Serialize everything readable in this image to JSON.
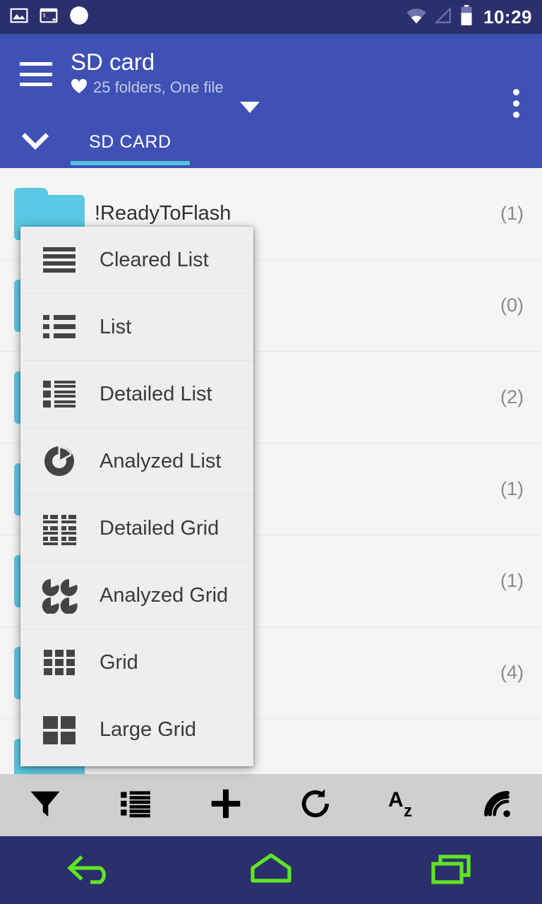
{
  "status_bar": {
    "icons": [
      "image-icon",
      "terminal-icon",
      "circle-icon"
    ],
    "wifi_icon": "wifi-icon",
    "signal_icon": "signal-icon",
    "battery_icon": "battery-icon",
    "time": "10:29",
    "background": "#2b2f6b"
  },
  "app_bar": {
    "menu_icon": "hamburger-menu-icon",
    "title": "SD card",
    "favorite_icon": "heart-icon",
    "subtitle": "25 folders, One file",
    "path_dropdown_icon": "caret-down-icon",
    "overflow_icon": "more-vertical-icon",
    "background": "#3f51b5"
  },
  "tab_strip": {
    "expander_icon": "chevron-down-icon",
    "tabs": [
      {
        "label": "SD CARD",
        "selected": true
      }
    ],
    "indicator_color": "#4fc3de"
  },
  "file_list": {
    "rows": [
      {
        "icon": "folder-icon",
        "name": "!ReadyToFlash",
        "count": "(1)"
      },
      {
        "icon": "folder-icon",
        "name": "",
        "count": "(0)"
      },
      {
        "icon": "folder-icon",
        "name": "",
        "count": "(2)"
      },
      {
        "icon": "folder-icon",
        "name": "",
        "count": "(1)"
      },
      {
        "icon": "folder-icon",
        "name": "",
        "count": "(1)"
      },
      {
        "icon": "folder-icon",
        "name": "",
        "count": "(4)"
      },
      {
        "icon": "folder-icon",
        "name": "",
        "count": ""
      }
    ],
    "folder_color": "#5ac8e4",
    "background": "#f5f5f5"
  },
  "view_menu": {
    "background": "#eeeeee",
    "items": [
      {
        "label": "Cleared List",
        "icon": "cleared-list-icon"
      },
      {
        "label": "List",
        "icon": "list-icon"
      },
      {
        "label": "Detailed List",
        "icon": "detailed-list-icon"
      },
      {
        "label": "Analyzed List",
        "icon": "analyzed-list-icon"
      },
      {
        "label": "Detailed Grid",
        "icon": "detailed-grid-icon"
      },
      {
        "label": "Analyzed Grid",
        "icon": "analyzed-grid-icon"
      },
      {
        "label": "Grid",
        "icon": "grid-icon"
      },
      {
        "label": "Large Grid",
        "icon": "large-grid-icon"
      }
    ]
  },
  "bottom_toolbar": {
    "background": "#cfcfcf",
    "buttons": [
      {
        "icon": "filter-icon",
        "name": "filter-button"
      },
      {
        "icon": "list-view-icon",
        "name": "view-mode-button"
      },
      {
        "icon": "plus-icon",
        "name": "add-button"
      },
      {
        "icon": "refresh-icon",
        "name": "refresh-button"
      },
      {
        "icon": "sort-az-icon",
        "name": "sort-button"
      },
      {
        "icon": "signal-icon",
        "name": "network-button"
      }
    ]
  },
  "nav_bar": {
    "background": "#2b2f6b",
    "accent": "#5ee622",
    "buttons": [
      {
        "icon": "back-icon",
        "name": "nav-back-button"
      },
      {
        "icon": "home-icon",
        "name": "nav-home-button"
      },
      {
        "icon": "recents-icon",
        "name": "nav-recents-button"
      }
    ]
  }
}
